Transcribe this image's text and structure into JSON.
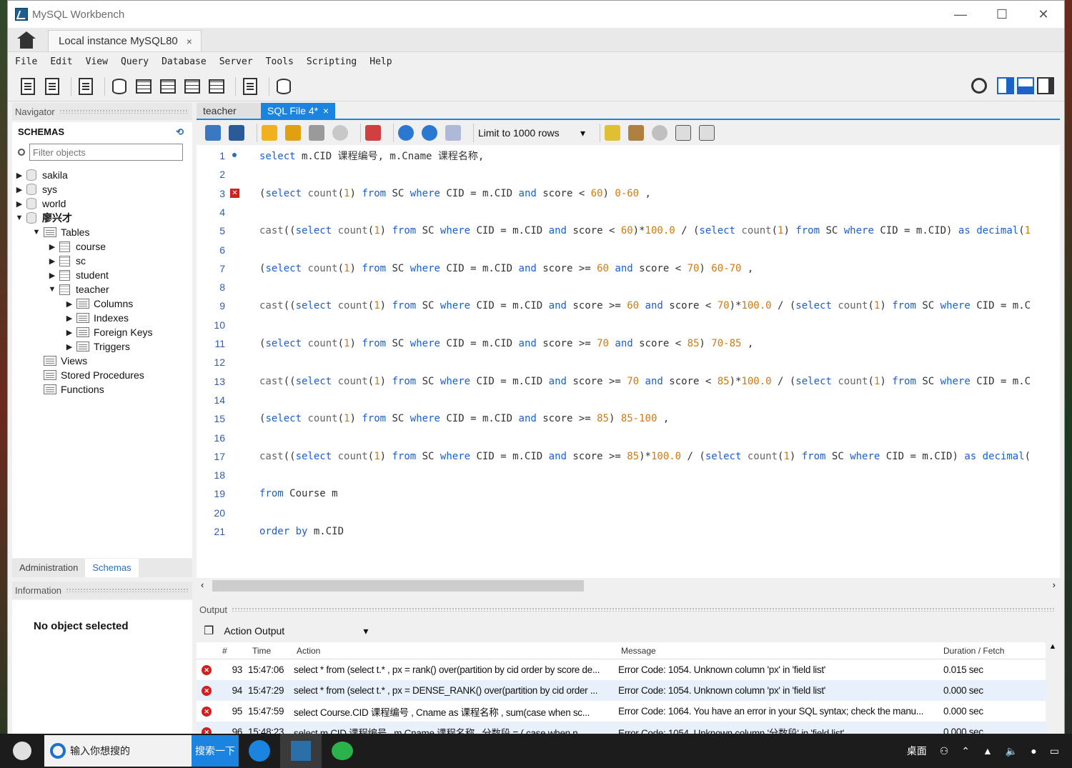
{
  "window": {
    "title": "MySQL Workbench",
    "minimize": "—",
    "maximize": "☐",
    "close": "✕"
  },
  "connection_tab": {
    "label": "Local instance MySQL80",
    "close": "×"
  },
  "menu": [
    "File",
    "Edit",
    "View",
    "Query",
    "Database",
    "Server",
    "Tools",
    "Scripting",
    "Help"
  ],
  "navigator": {
    "title": "Navigator",
    "schemas_header": "SCHEMAS",
    "filter_placeholder": "Filter objects",
    "tree": {
      "sakila": "sakila",
      "sys": "sys",
      "world": "world",
      "mine": "廖兴才",
      "tables": "Tables",
      "course": "course",
      "sc": "sc",
      "student": "student",
      "teacher": "teacher",
      "columns": "Columns",
      "indexes": "Indexes",
      "foreign_keys": "Foreign Keys",
      "triggers": "Triggers",
      "views": "Views",
      "stored_procedures": "Stored Procedures",
      "functions": "Functions"
    },
    "bottom_tabs": {
      "administration": "Administration",
      "schemas": "Schemas"
    },
    "information_title": "Information",
    "no_object": "No object selected"
  },
  "editor": {
    "tabs": {
      "teacher": "teacher",
      "sqlfile": "SQL File 4*",
      "close": "×"
    },
    "limit": "Limit to 1000 rows",
    "lines": [
      "select m.CID 课程编号, m.Cname 课程名称,",
      "",
      "(select count(1) from SC where CID = m.CID and score < 60) 0-60 ,",
      "",
      "cast((select count(1) from SC where CID = m.CID and score < 60)*100.0 / (select count(1) from SC where CID = m.CID) as decimal(1",
      "",
      "(select count(1) from SC where CID = m.CID and score >= 60 and score < 70) 60-70 ,",
      "",
      "cast((select count(1) from SC where CID = m.CID and score >= 60 and score < 70)*100.0 / (select count(1) from SC where CID = m.C",
      "",
      "(select count(1) from SC where CID = m.CID and score >= 70 and score < 85) 70-85 ,",
      "",
      "cast((select count(1) from SC where CID = m.CID and score >= 70 and score < 85)*100.0 / (select count(1) from SC where CID = m.C",
      "",
      "(select count(1) from SC where CID = m.CID and score >= 85) 85-100 ,",
      "",
      "cast((select count(1) from SC where CID = m.CID and score >= 85)*100.0 / (select count(1) from SC where CID = m.CID) as decimal(",
      "",
      "from Course m",
      "",
      "order by m.CID"
    ],
    "colors": {
      "keyword": "#1a5fd0",
      "number": "#d4780a",
      "func": "#666666",
      "text": "#333333"
    }
  },
  "output": {
    "title": "Output",
    "selector": "Action Output",
    "columns": [
      "#",
      "Time",
      "Action",
      "Message",
      "Duration / Fetch"
    ],
    "rows": [
      {
        "n": "93",
        "time": "15:47:06",
        "action": "select * from (select t.* , px = rank() over(partition by cid order by score de...",
        "message": "Error Code: 1054. Unknown column 'px' in 'field list'",
        "duration": "0.015 sec"
      },
      {
        "n": "94",
        "time": "15:47:29",
        "action": "select * from (select t.* , px = DENSE_RANK() over(partition by cid order ...",
        "message": "Error Code: 1054. Unknown column 'px' in 'field list'",
        "duration": "0.000 sec"
      },
      {
        "n": "95",
        "time": "15:47:59",
        "action": "select Course.CID 课程编号 , Cname as 课程名称 ,  sum(case when sc...",
        "message": "Error Code: 1064. You have an error in your SQL syntax; check the manu...",
        "duration": "0.000 sec"
      },
      {
        "n": "96",
        "time": "15:48:23",
        "action": "select m.CID 课程编号 , m.Cname 课程名称 , 分数段 = (  case when n....",
        "message": "Error Code: 1054. Unknown column '分数段' in 'field list'",
        "duration": "0.000 sec"
      }
    ]
  },
  "taskbar": {
    "search_text": "输入你想搜的",
    "search_button": "搜索一下",
    "desktop": "桌面"
  }
}
